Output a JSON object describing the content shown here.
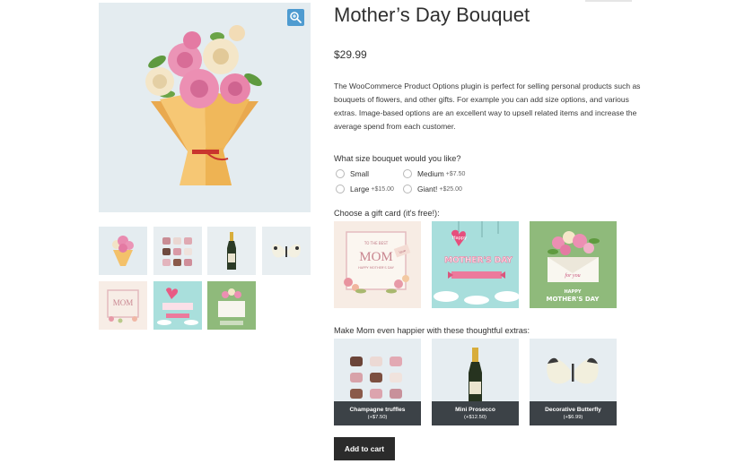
{
  "product": {
    "title": "Mother’s Day Bouquet",
    "price": "$29.99",
    "description": "The WooCommerce Product Options plugin is perfect for selling personal products such as bouquets of flowers, and other gifts. For example you can add size options, and various extras. Image-based options are an excellent way to upsell related items and increase the average spend from each customer."
  },
  "gallery": {
    "zoom_icon": "magnifier-zoom-icon",
    "main_image": "bouquet-image",
    "thumbnails": [
      "bouquet",
      "truffles",
      "prosecco",
      "butterfly",
      "card-mom-floral",
      "card-happy-mothers-day",
      "card-envelope-flowers"
    ]
  },
  "size_question": {
    "label": "What size bouquet would you like?",
    "options": [
      {
        "label": "Small",
        "price": ""
      },
      {
        "label": "Medium",
        "price": "+$7.50"
      },
      {
        "label": "Large",
        "price": "+$15.00"
      },
      {
        "label": "Giant!",
        "price": "+$25.00"
      }
    ]
  },
  "gift_card_question": {
    "label": "Choose a gift card (it's free!):",
    "cards": [
      {
        "text_1": "TO THE BEST",
        "text_2": "MOM",
        "text_3": "HAPPY MOTHER'S DAY",
        "tag": "love"
      },
      {
        "text_1": "Happy",
        "text_2": "MOTHER'S DAY",
        "text_3": ""
      },
      {
        "text_1": "for you",
        "text_2": "HAPPY",
        "text_3": "MOTHER'S DAY"
      }
    ]
  },
  "extras_question": {
    "label": "Make Mom even happier with these thoughtful extras:",
    "items": [
      {
        "name": "Champagne truffles",
        "price": "(+$7.50)"
      },
      {
        "name": "Mini Prosecco",
        "price": "(+$12.50)"
      },
      {
        "name": "Decorative Butterfly",
        "price": "(+$6.99)"
      }
    ]
  },
  "cart": {
    "add_label": "Add to cart"
  },
  "colors": {
    "image_bg": "#e4ecf0",
    "zoom_button": "#4e9bd0",
    "caption_bg": "#3c4247",
    "add_to_cart_bg": "#2b2b2b",
    "bouquet_wrap": "#f3c16a",
    "rose_pink": "#e987ad",
    "card_green": "#8fba7b",
    "card_teal": "#a7dedd"
  }
}
